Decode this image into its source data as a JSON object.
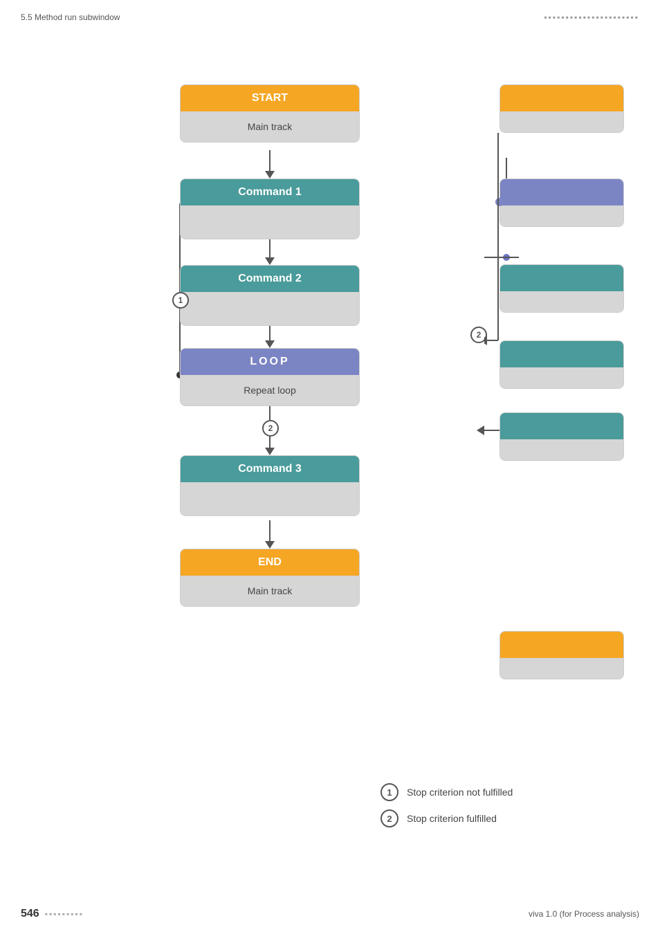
{
  "header": {
    "section": "5.5 Method run subwindow",
    "dots_header": "▪▪▪▪▪▪▪▪▪▪▪▪▪▪▪▪▪▪▪▪▪▪"
  },
  "flow": {
    "start_block": {
      "header": "START",
      "body": "Main track"
    },
    "command1": {
      "header": "Command 1",
      "body": ""
    },
    "command2": {
      "header": "Command 2",
      "body": ""
    },
    "loop_block": {
      "header": "LOOP",
      "body": "Repeat loop"
    },
    "command3": {
      "header": "Command 3",
      "body": ""
    },
    "end_block": {
      "header": "END",
      "body": "Main track"
    }
  },
  "legend": {
    "item1": {
      "number": "1",
      "text": "Stop criterion not fulfilled"
    },
    "item2": {
      "number": "2",
      "text": "Stop criterion fulfilled"
    }
  },
  "footer": {
    "page_number": "546",
    "dots": "▪▪▪▪▪▪▪▪▪",
    "version": "viva 1.0 (for Process analysis)"
  }
}
